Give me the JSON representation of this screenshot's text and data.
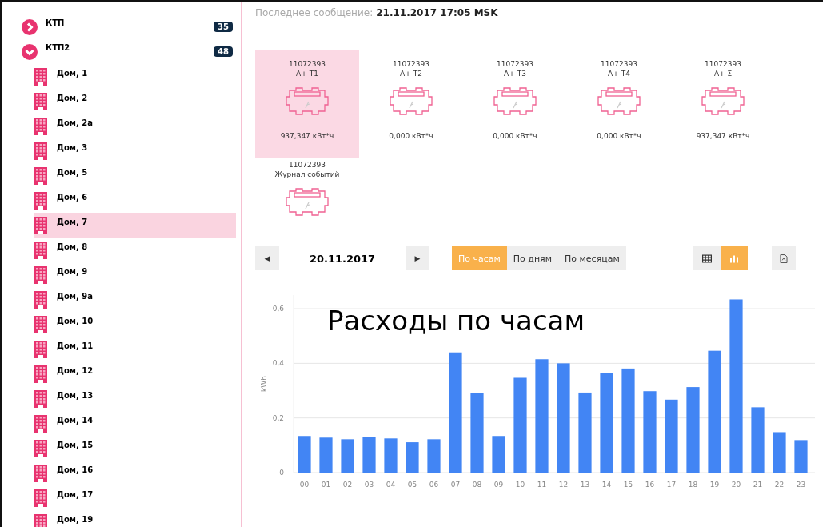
{
  "sidebar": {
    "groups": [
      {
        "label": "КТП",
        "count": "35",
        "expanded": false
      },
      {
        "label": "КТП2",
        "count": "48",
        "expanded": true,
        "items": [
          {
            "label": "Дом, 1",
            "selected": false
          },
          {
            "label": "Дом, 2",
            "selected": false
          },
          {
            "label": "Дом, 2а",
            "selected": false
          },
          {
            "label": "Дом, 3",
            "selected": false
          },
          {
            "label": "Дом, 5",
            "selected": false
          },
          {
            "label": "Дом, 6",
            "selected": false
          },
          {
            "label": "Дом, 7",
            "selected": true
          },
          {
            "label": "Дом, 8",
            "selected": false
          },
          {
            "label": "Дом, 9",
            "selected": false
          },
          {
            "label": "Дом, 9а",
            "selected": false
          },
          {
            "label": "Дом, 10",
            "selected": false
          },
          {
            "label": "Дом, 11",
            "selected": false
          },
          {
            "label": "Дом, 12",
            "selected": false
          },
          {
            "label": "Дом, 13",
            "selected": false
          },
          {
            "label": "Дом, 14",
            "selected": false
          },
          {
            "label": "Дом, 15",
            "selected": false
          },
          {
            "label": "Дом, 16",
            "selected": false
          },
          {
            "label": "Дом, 17",
            "selected": false
          },
          {
            "label": "Дом, 19",
            "selected": false
          }
        ]
      }
    ]
  },
  "last_message": {
    "label": "Последнее сообщение:",
    "value": "21.11.2017 17:05 MSK"
  },
  "meters": [
    {
      "id": "11072393",
      "label": "A+ T1",
      "reading": "937,347 кВт*ч",
      "selected": true
    },
    {
      "id": "11072393",
      "label": "A+ T2",
      "reading": "0,000 кВт*ч",
      "selected": false
    },
    {
      "id": "11072393",
      "label": "A+ T3",
      "reading": "0,000 кВт*ч",
      "selected": false
    },
    {
      "id": "11072393",
      "label": "A+ T4",
      "reading": "0,000 кВт*ч",
      "selected": false
    },
    {
      "id": "11072393",
      "label": "A+ Σ",
      "reading": "937,347 кВт*ч",
      "selected": false
    },
    {
      "id": "11072393",
      "label": "Журнал событий",
      "selected": false
    }
  ],
  "toolbar": {
    "prev": "◀",
    "date": "20.11.2017",
    "next": "▶",
    "periods": [
      {
        "label": "По часам",
        "selected": true
      },
      {
        "label": "По дням",
        "selected": false
      },
      {
        "label": "По месяцам",
        "selected": false
      }
    ],
    "views": [
      {
        "kind": "table",
        "selected": false
      },
      {
        "kind": "chart",
        "selected": true
      }
    ]
  },
  "chart": {
    "chart_data": {
      "type": "bar",
      "title": "Расходы по часам",
      "ylabel": "kWh",
      "categories": [
        "00",
        "01",
        "02",
        "03",
        "04",
        "05",
        "06",
        "07",
        "08",
        "09",
        "10",
        "11",
        "12",
        "13",
        "14",
        "15",
        "16",
        "17",
        "18",
        "19",
        "20",
        "21",
        "22",
        "23"
      ],
      "values": [
        0.134,
        0.128,
        0.122,
        0.131,
        0.125,
        0.111,
        0.122,
        0.44,
        0.29,
        0.134,
        0.347,
        0.415,
        0.4,
        0.293,
        0.364,
        0.381,
        0.298,
        0.267,
        0.313,
        0.446,
        0.634,
        0.239,
        0.148,
        0.119
      ],
      "grid": true,
      "ylim": [
        0,
        0.65
      ],
      "yticks": [
        {
          "value": 0,
          "label": "0"
        },
        {
          "value": 0.2,
          "label": "0,2"
        },
        {
          "value": 0.4,
          "label": "0,4"
        },
        {
          "value": 0.6,
          "label": "0,6"
        }
      ]
    }
  }
}
